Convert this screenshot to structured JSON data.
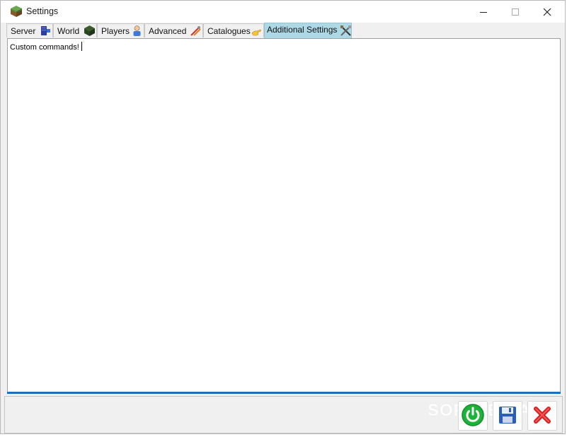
{
  "window": {
    "title": "Settings",
    "icon": "grass-block-icon"
  },
  "titlebar_controls": [
    "minimize-icon",
    "maximize-icon",
    "close-icon"
  ],
  "tabs": [
    {
      "label": "Server",
      "icon": "server-icon",
      "active": false
    },
    {
      "label": "World",
      "icon": "world-block-icon",
      "active": false
    },
    {
      "label": "Players",
      "icon": "player-icon",
      "active": false
    },
    {
      "label": "Advanced",
      "icon": "advanced-tools-icon",
      "active": false
    },
    {
      "label": "Catalogues",
      "icon": "catalogue-hand-icon",
      "active": false
    },
    {
      "label": "Additional Settings",
      "icon": "crossed-tools-icon",
      "active": true
    }
  ],
  "editor": {
    "value": "Custom commands!"
  },
  "buttons": [
    {
      "name": "power-icon",
      "color": "#1db33a"
    },
    {
      "name": "save-icon",
      "color": "#2a5fb8"
    },
    {
      "name": "cancel-icon",
      "color": "#d62020"
    }
  ],
  "watermark": "SOFTPEDIA",
  "colors": {
    "active_tab": "#add8e6",
    "progress_line": "#1a6fc0"
  }
}
